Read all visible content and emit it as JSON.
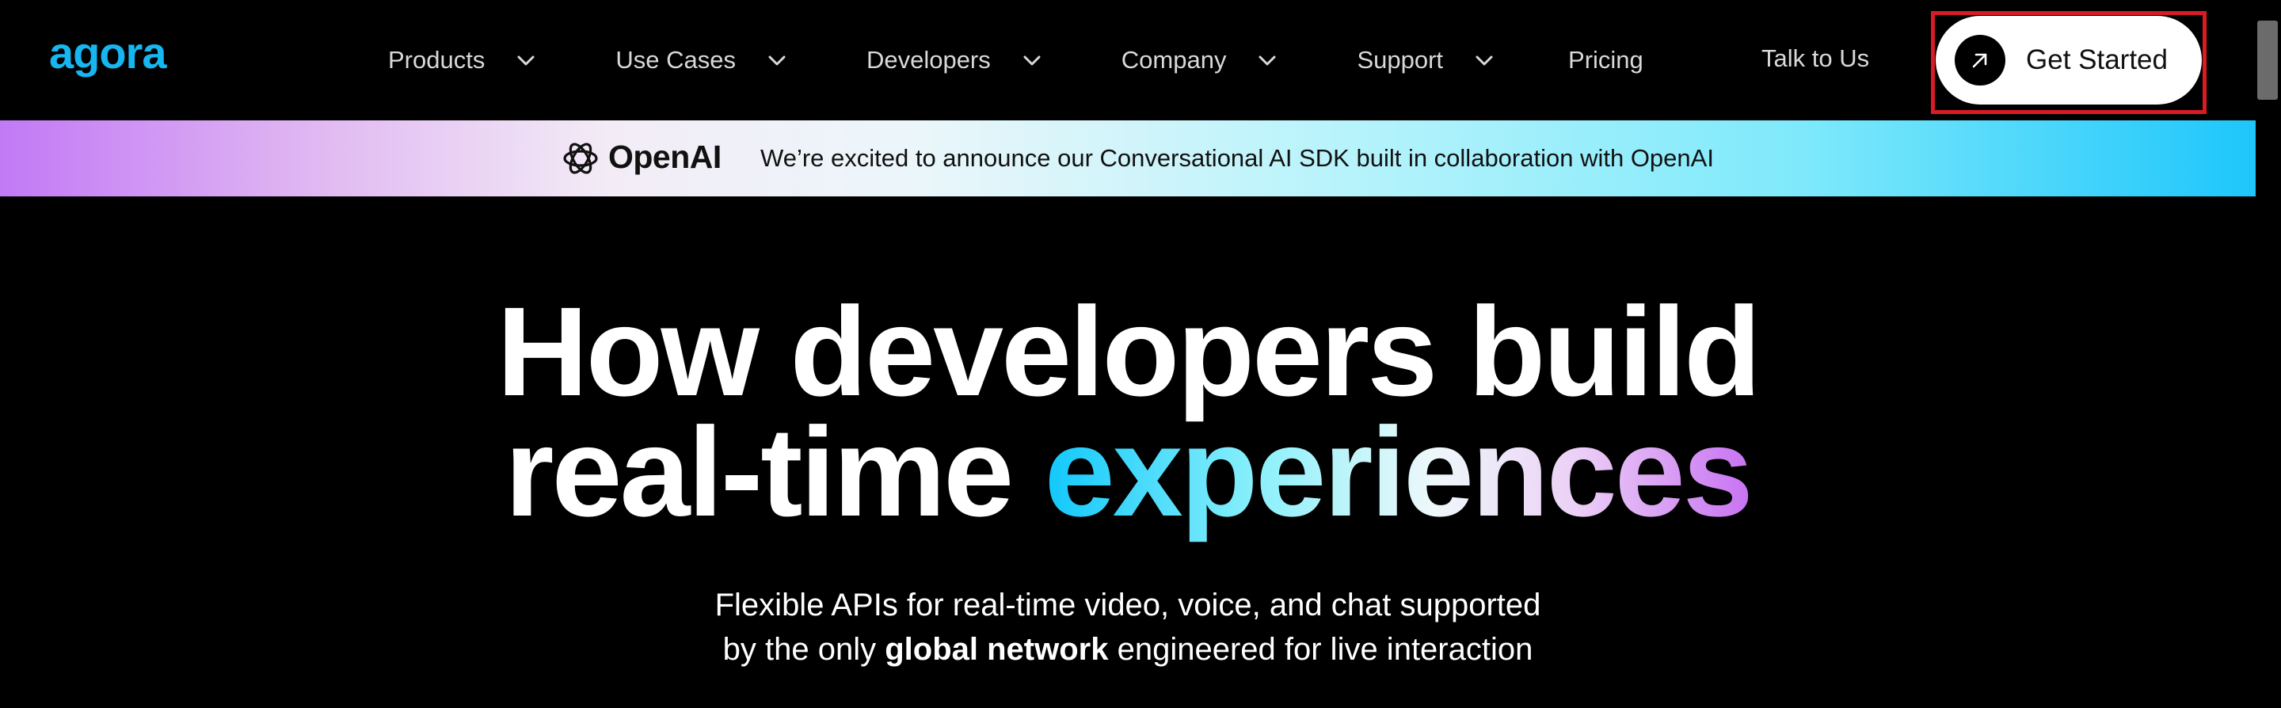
{
  "brand": {
    "logo_text": "agora",
    "accent_color": "#16b6f0"
  },
  "nav": {
    "items": [
      {
        "label": "Products",
        "has_dropdown": true
      },
      {
        "label": "Use Cases",
        "has_dropdown": true
      },
      {
        "label": "Developers",
        "has_dropdown": true
      },
      {
        "label": "Company",
        "has_dropdown": true
      },
      {
        "label": "Support",
        "has_dropdown": true
      },
      {
        "label": "Pricing",
        "has_dropdown": false
      }
    ],
    "talk_link": "Talk to Us",
    "cta": {
      "label": "Get Started",
      "icon": "arrow-up-right-icon"
    }
  },
  "banner": {
    "partner_logo_text": "OpenAI",
    "partner_icon": "openai-icon",
    "message": "We’re excited to announce our Conversational AI SDK built in collaboration with OpenAI"
  },
  "hero": {
    "title_line1": "How developers build",
    "title_line2_plain": "real-time",
    "title_line2_accent": "experiences",
    "subtitle_line1": "Flexible APIs for real-time video, voice, and chat supported",
    "subtitle_line2_before": "by the only",
    "subtitle_line2_bold": "global network",
    "subtitle_line2_after": "engineered for live interaction"
  },
  "colors": {
    "background": "#000000",
    "nav_text": "#d9d9d9",
    "cta_background": "#ffffff",
    "highlight_border": "#d81b24"
  }
}
